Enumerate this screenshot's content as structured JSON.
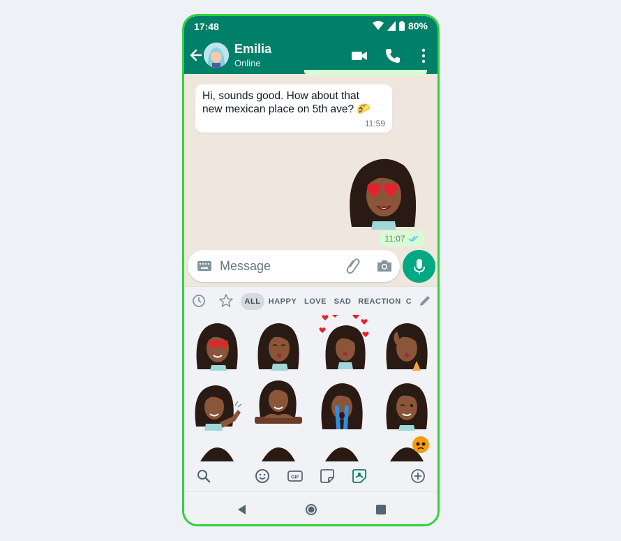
{
  "status_bar": {
    "time": "17:48",
    "battery": "80%"
  },
  "header": {
    "contact_name": "Emilia",
    "contact_status": "Online"
  },
  "messages": [
    {
      "direction": "incoming",
      "text_line1": "Hi, sounds good. How about that",
      "text_line2": "new mexican place on 5th ave? 🌮",
      "time": "11:59"
    },
    {
      "direction": "outgoing",
      "type": "sticker",
      "sticker": "heart-eyes-avatar",
      "time": "11:07",
      "status": "read"
    }
  ],
  "composer": {
    "placeholder": "Message"
  },
  "sticker_tabs": [
    "ALL",
    "HAPPY",
    "LOVE",
    "SAD",
    "REACTION",
    "C"
  ],
  "active_tab": "ALL",
  "stickers": [
    "heart-eyes",
    "kiss",
    "blowing-hearts",
    "wink-kiss",
    "wave",
    "lying-down",
    "crying",
    "wink",
    "partial",
    "partial",
    "partial",
    "partial-with-emoji"
  ],
  "bottom_bar": [
    "search",
    "emoji",
    "gif",
    "sticker",
    "avatar-sticker",
    "add"
  ],
  "colors": {
    "brand": "#008069",
    "accent": "#00a884",
    "outgoing_bubble": "#d9fdd3",
    "frame": "#31d13d"
  }
}
